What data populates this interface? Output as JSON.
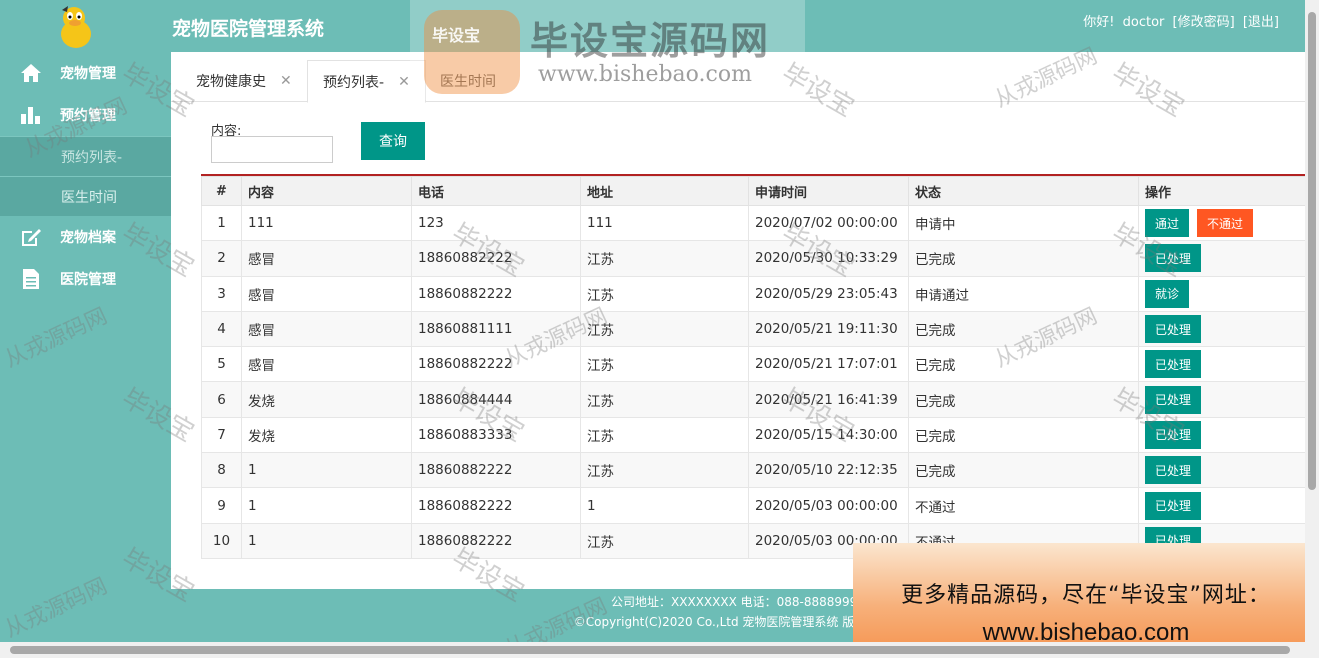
{
  "header": {
    "app_title": "宠物医院管理系统",
    "greeting": "你好!",
    "username": "doctor",
    "change_password": "[修改密码]",
    "logout": "[退出]"
  },
  "sidebar": {
    "items": [
      {
        "label": "宠物管理",
        "icon": "home-icon"
      },
      {
        "label": "预约管理",
        "icon": "bar-chart-icon"
      },
      {
        "label": "预约列表-",
        "icon": ""
      },
      {
        "label": "医生时间",
        "icon": ""
      },
      {
        "label": "宠物档案",
        "icon": "edit-icon"
      },
      {
        "label": "医院管理",
        "icon": "document-icon"
      }
    ]
  },
  "tabs": [
    {
      "label": "宠物健康史"
    },
    {
      "label": "预约列表-"
    },
    {
      "label": "医生时间"
    }
  ],
  "search": {
    "label": "内容:",
    "value": "",
    "button": "查询"
  },
  "table": {
    "headers": [
      "#",
      "内容",
      "电话",
      "地址",
      "申请时间",
      "状态",
      "操作"
    ],
    "rows": [
      {
        "n": "1",
        "content": "111",
        "phone": "123",
        "addr": "111",
        "time": "2020/07/02 00:00:00",
        "status": "申请中",
        "actions": [
          "通过",
          "不通过"
        ]
      },
      {
        "n": "2",
        "content": "感冒",
        "phone": "18860882222",
        "addr": "江苏",
        "time": "2020/05/30 10:33:29",
        "status": "已完成",
        "actions": [
          "已处理"
        ]
      },
      {
        "n": "3",
        "content": "感冒",
        "phone": "18860882222",
        "addr": "江苏",
        "time": "2020/05/29 23:05:43",
        "status": "申请通过",
        "actions": [
          "就诊"
        ]
      },
      {
        "n": "4",
        "content": "感冒",
        "phone": "18860881111",
        "addr": "江苏",
        "time": "2020/05/21 19:11:30",
        "status": "已完成",
        "actions": [
          "已处理"
        ]
      },
      {
        "n": "5",
        "content": "感冒",
        "phone": "18860882222",
        "addr": "江苏",
        "time": "2020/05/21 17:07:01",
        "status": "已完成",
        "actions": [
          "已处理"
        ]
      },
      {
        "n": "6",
        "content": "发烧",
        "phone": "18860884444",
        "addr": "江苏",
        "time": "2020/05/21 16:41:39",
        "status": "已完成",
        "actions": [
          "已处理"
        ]
      },
      {
        "n": "7",
        "content": "发烧",
        "phone": "18860883333",
        "addr": "江苏",
        "time": "2020/05/15 14:30:00",
        "status": "已完成",
        "actions": [
          "已处理"
        ]
      },
      {
        "n": "8",
        "content": "1",
        "phone": "18860882222",
        "addr": "江苏",
        "time": "2020/05/10 22:12:35",
        "status": "已完成",
        "actions": [
          "已处理"
        ]
      },
      {
        "n": "9",
        "content": "1",
        "phone": "18860882222",
        "addr": "1",
        "time": "2020/05/03 00:00:00",
        "status": "不通过",
        "actions": [
          "已处理"
        ]
      },
      {
        "n": "10",
        "content": "1",
        "phone": "18860882222",
        "addr": "江苏",
        "time": "2020/05/03 00:00:00",
        "status": "不通过",
        "actions": [
          "已处理"
        ]
      }
    ]
  },
  "footer": {
    "address_line": "公司地址：XXXXXXXX 电话：088-88889999",
    "copyright": "©Copyright(C)2020 Co.,Ltd 宠物医院管理系统 版权所有©"
  },
  "watermark": {
    "brand": "毕设宝源码网",
    "badge": "毕设宝",
    "url": "www.bishebao.com",
    "tile_a": "毕设宝",
    "tile_b": "从戎源码网"
  },
  "ad": {
    "line1": "更多精品源码，尽在“毕设宝”网址：",
    "line2": "www.bishebao.com"
  },
  "colors": {
    "teal": "#6dbdb6",
    "button_green": "#009688",
    "button_orange": "#ff5722",
    "table_top_border": "#b22222"
  }
}
